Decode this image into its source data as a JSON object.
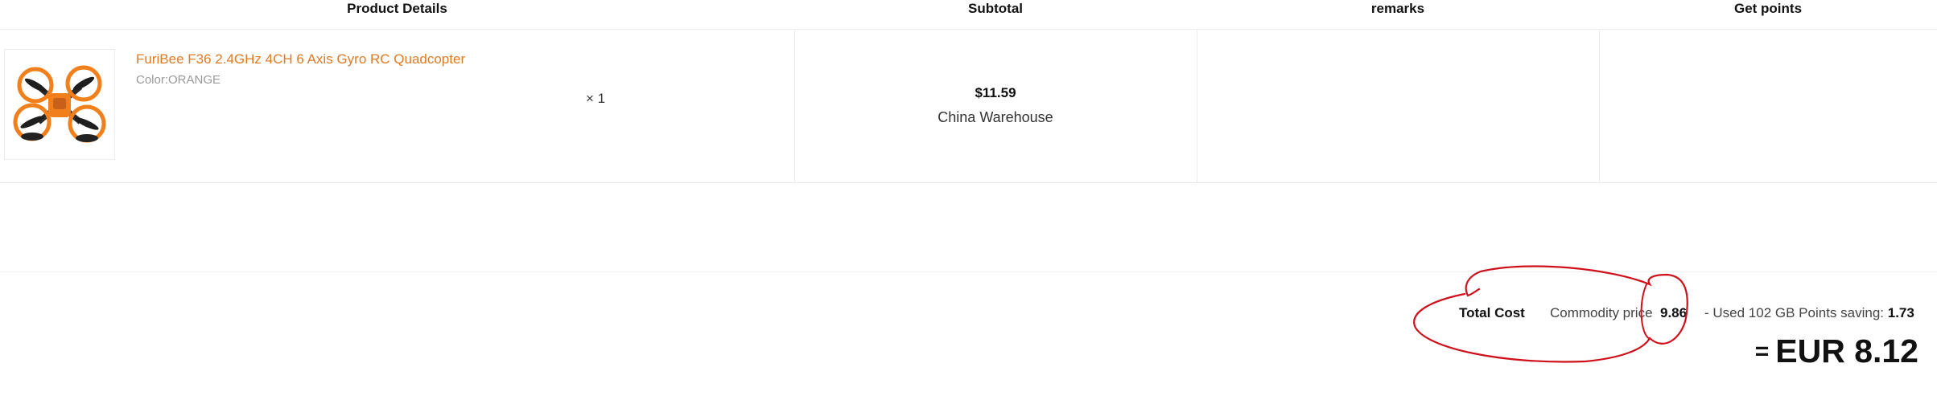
{
  "header": {
    "product_details": "Product Details",
    "subtotal": "Subtotal",
    "remarks": "remarks",
    "get_points": "Get points"
  },
  "item": {
    "name": "FuriBee F36 2.4GHz 4CH 6 Axis Gyro RC Quadcopter",
    "color": "Color:ORANGE",
    "quantity": "× 1",
    "price": "$11.59",
    "warehouse": "China Warehouse",
    "image_icon": "quadcopter-image"
  },
  "totals": {
    "label": "Total Cost",
    "commodity_label": "Commodity price",
    "commodity_value": "9.86",
    "points_prefix": "- Used 102 GB Points saving:",
    "points_value": "1.73",
    "equals": "=",
    "grand_total": "EUR 8.12"
  },
  "colors": {
    "product_link": "#e07a23",
    "annotation": "#d0101a",
    "drone_body": "#f07f1c"
  }
}
